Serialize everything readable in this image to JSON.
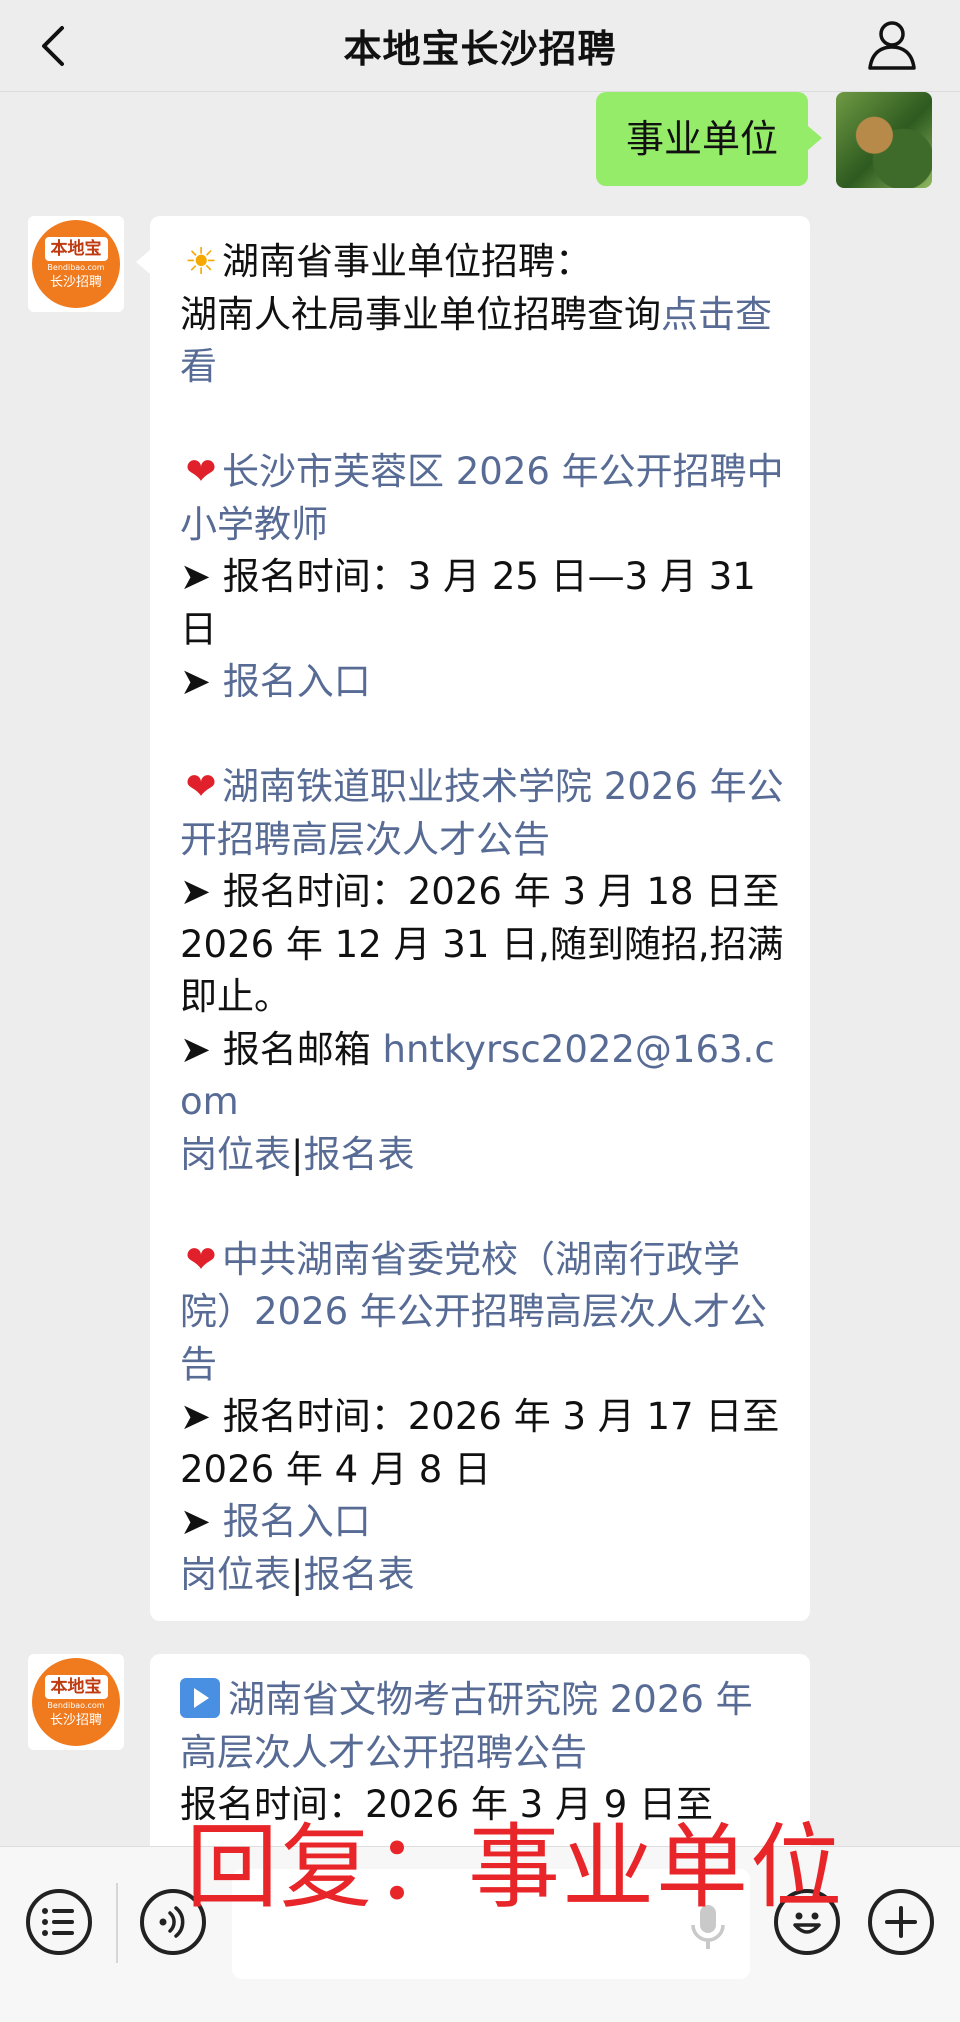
{
  "header": {
    "back_icon": "chevron-left-icon",
    "title": "本地宝长沙招聘",
    "profile_icon": "person-icon"
  },
  "user_message": {
    "text": "事业单位",
    "avatar": "user-avatar-photo"
  },
  "bot": {
    "avatar_logo_top": "本地宝",
    "avatar_logo_url": "Bendibao.com",
    "avatar_logo_bottom": "长沙招聘"
  },
  "message1": {
    "intro_title": "湖南省事业单位招聘：",
    "intro_text": "湖南人社局事业单位招聘查询",
    "intro_link": "点击查看",
    "item1": {
      "title": "长沙市芙蓉区 2026 年公开招聘中小学教师",
      "time": "报名时间：3 月 25 日—3 月 31 日",
      "entry_link": "报名入口"
    },
    "item2": {
      "title": "湖南铁道职业技术学院 2026 年公开招聘高层次人才公告",
      "time": "报名时间：2026 年 3 月 18 日至 2026 年 12 月 31 日,随到随招,招满即止。",
      "email_label": "报名邮箱 ",
      "email": "hntkyrsc2022@163.com",
      "link_positions": "岗位表",
      "separator": "|",
      "link_form": "报名表"
    },
    "item3": {
      "title": "中共湖南省委党校（湖南行政学院）2026 年公开招聘高层次人才公告",
      "time": "报名时间：2026 年 3 月 17 日至 2026 年 4 月 8 日",
      "entry_link": "报名入口",
      "link_positions": "岗位表",
      "separator": "|",
      "link_form": "报名表"
    }
  },
  "message2": {
    "title": "湖南省文物考古研究院 2026 年高层次人才公开招聘公告",
    "time_partial": "报名时间：2026 年 3 月 9 日至"
  },
  "symbols": {
    "arrow": "➤ ",
    "heart": "❤",
    "sun": "☀"
  },
  "bottom_bar": {
    "menu_icon": "list-menu-icon",
    "voice_icon": "voice-icon",
    "mic_icon": "microphone-icon",
    "emoji_icon": "emoji-icon",
    "plus_icon": "plus-icon"
  },
  "overlay_text": "回复：事业单位",
  "colors": {
    "link": "#576b95",
    "user_bubble": "#95ec69",
    "overlay": "#e8262a",
    "brand_orange": "#f07a1e"
  }
}
